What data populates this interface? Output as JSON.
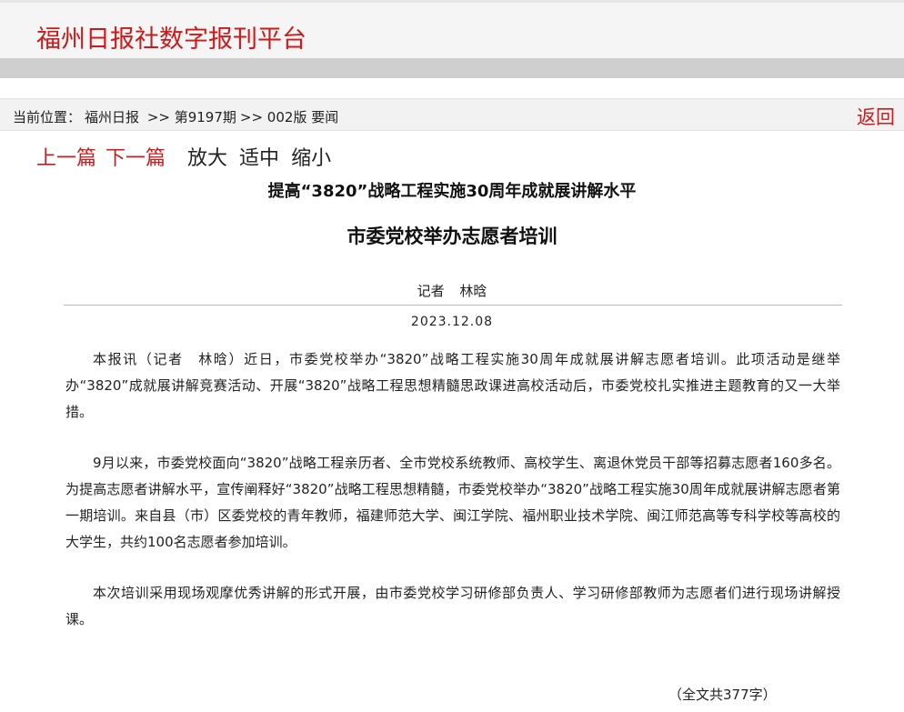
{
  "header": {
    "logo_text": "福州日报社数字报刊平台"
  },
  "breadcrumb": {
    "prefix": "当前位置：",
    "site": "福州日报",
    "issue": ">> 第9197期",
    "page": ">> 002版 要闻"
  },
  "back_label": "返回",
  "nav": {
    "prev": "上一篇",
    "next": "下一篇",
    "zoom_in": "放大",
    "fit": "适中",
    "zoom_out": "缩小"
  },
  "article": {
    "subtitle": "提高“3820”战略工程实施30周年成就展讲解水平",
    "title": "市委党校举办志愿者培训",
    "author": "记者 林晗",
    "date": "2023.12.08",
    "paragraphs": [
      "本报讯（记者　林晗）近日，市委党校举办“3820”战略工程实施30周年成就展讲解志愿者培训。此项活动是继举办“3820”成就展讲解竞赛活动、开展“3820”战略工程思想精髓思政课进高校活动后，市委党校扎实推进主题教育的又一大举措。",
      "9月以来，市委党校面向“3820”战略工程亲历者、全市党校系统教师、高校学生、离退休党员干部等招募志愿者160多名。为提高志愿者讲解水平，宣传阐释好“3820”战略工程思想精髓，市委党校举办“3820”战略工程实施30周年成就展讲解志愿者第一期培训。来自县（市）区委党校的青年教师，福建师范大学、闽江学院、福州职业技术学院、闽江师范高等专科学校等高校的大学生，共约100名志愿者参加培训。",
      "本次培训采用现场观摩优秀讲解的形式开展，由市委党校学习研修部负责人、学习研修部教师为志愿者们进行现场讲解授课。"
    ],
    "word_count": "（全文共377字）"
  }
}
